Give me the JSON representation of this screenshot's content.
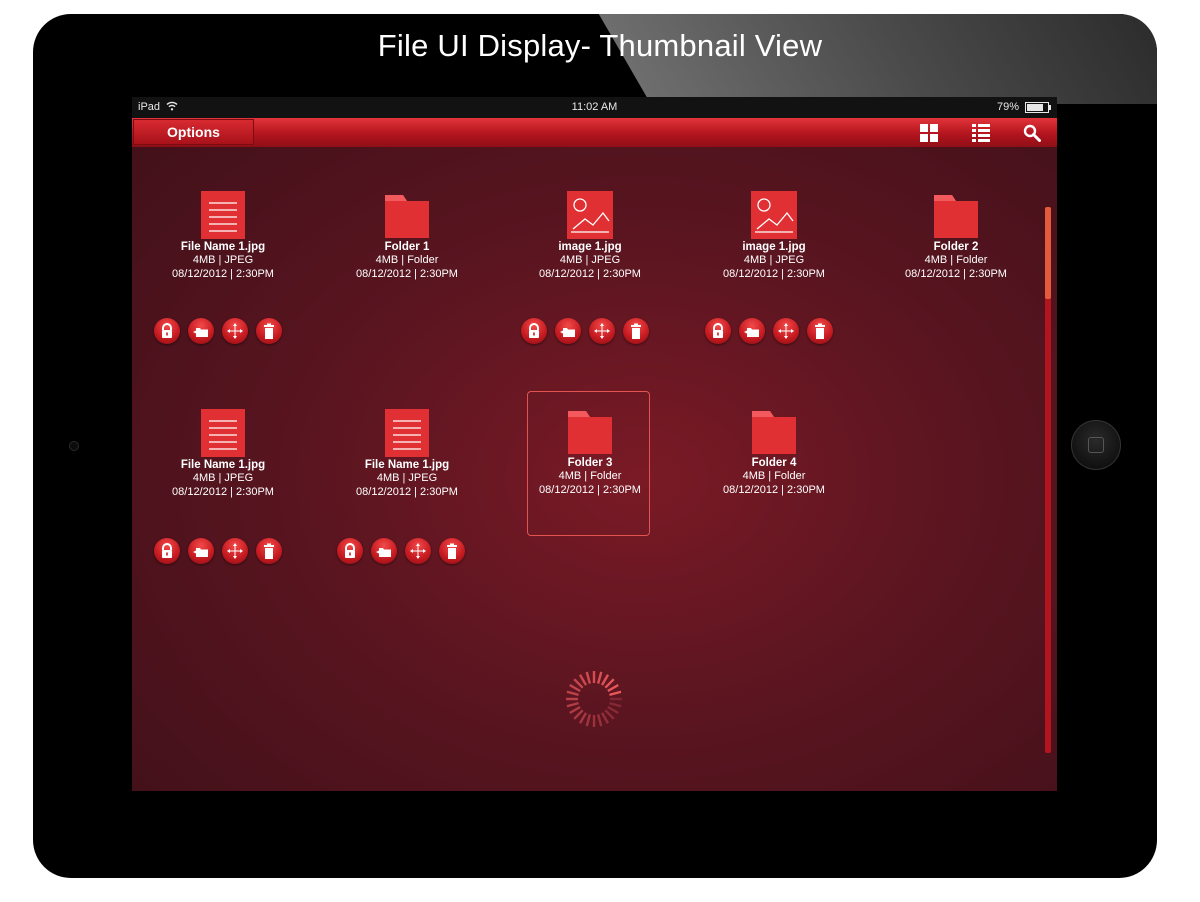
{
  "page_title": "File UI Display- Thumbnail View",
  "status_bar": {
    "device": "iPad",
    "time": "11:02 AM",
    "battery": "79%",
    "battery_level": 0.79
  },
  "toolbar": {
    "options_label": "Options",
    "icons": [
      "grid-view-icon",
      "list-view-icon",
      "search-icon"
    ]
  },
  "colors": {
    "accent": "#c81c22",
    "toolbar": "#b3141d",
    "background": "#5a1520",
    "selection": "#e3534f"
  },
  "files": [
    {
      "type": "document",
      "name": "File Name 1.jpg",
      "meta": "4MB | JPEG",
      "date": "08/12/2012 | 2:30PM",
      "has_actions": true
    },
    {
      "type": "folder",
      "name": "Folder 1",
      "meta": "4MB | Folder",
      "date": "08/12/2012 | 2:30PM",
      "has_actions": false
    },
    {
      "type": "image",
      "name": "image 1.jpg",
      "meta": "4MB | JPEG",
      "date": "08/12/2012 | 2:30PM",
      "has_actions": true
    },
    {
      "type": "image",
      "name": "image 1.jpg",
      "meta": "4MB | JPEG",
      "date": "08/12/2012 | 2:30PM",
      "has_actions": true
    },
    {
      "type": "folder",
      "name": "Folder 2",
      "meta": "4MB | Folder",
      "date": "08/12/2012 | 2:30PM",
      "has_actions": false
    },
    {
      "type": "document",
      "name": "File Name 1.jpg",
      "meta": "4MB | JPEG",
      "date": "08/12/2012 | 2:30PM",
      "has_actions": true
    },
    {
      "type": "document",
      "name": "File Name 1.jpg",
      "meta": "4MB | JPEG",
      "date": "08/12/2012 | 2:30PM",
      "has_actions": true
    },
    {
      "type": "folder",
      "name": "Folder 3",
      "meta": "4MB | Folder",
      "date": "08/12/2012 | 2:30PM",
      "has_actions": false,
      "selected": true
    },
    {
      "type": "folder",
      "name": "Folder 4",
      "meta": "4MB | Folder",
      "date": "08/12/2012 | 2:30PM",
      "has_actions": false
    }
  ],
  "file_actions": [
    "lock-icon",
    "move-to-folder-icon",
    "move-icon",
    "delete-icon"
  ],
  "loading_indicator": "spinner-icon"
}
